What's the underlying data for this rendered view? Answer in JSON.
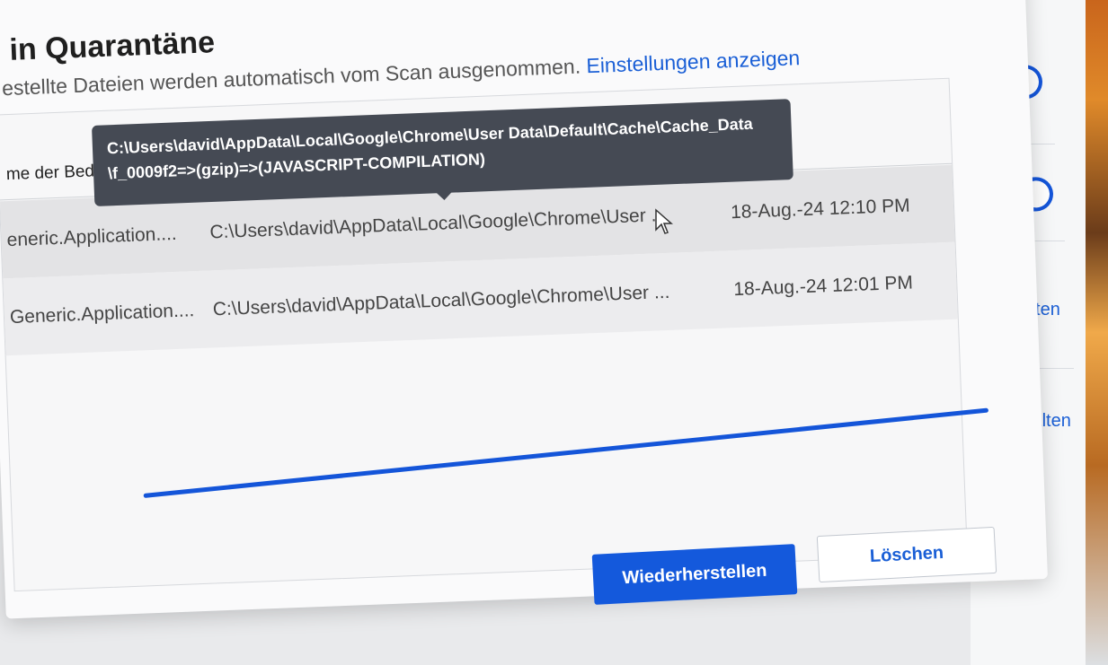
{
  "dialog": {
    "title": "in Quarantäne",
    "subtitle_text": "estellte Dateien werden automatisch vom Scan ausgenommen.",
    "subtitle_link": "Einstellungen anzeigen",
    "column_header": "me der Bed"
  },
  "tooltip": {
    "line1": "C:\\Users\\david\\AppData\\Local\\Google\\Chrome\\User Data\\Default\\Cache\\Cache_Data",
    "line2": "\\f_0009f2=>(gzip)=>(JAVASCRIPT-COMPILATION)"
  },
  "rows": [
    {
      "name": "eneric.Application....",
      "path": "C:\\Users\\david\\AppData\\Local\\Google\\Chrome\\User ...",
      "date": "18-Aug.-24 12:10 PM"
    },
    {
      "name": "Generic.Application....",
      "path": "C:\\Users\\david\\AppData\\Local\\Google\\Chrome\\User ...",
      "date": "18-Aug.-24 12:01 PM"
    }
  ],
  "progress": {
    "percent": 100,
    "color": "#1455d9"
  },
  "buttons": {
    "restore": "Wiederherstellen",
    "delete": "Löschen"
  },
  "side_panel": {
    "link1": "walten",
    "link2": "walten"
  },
  "colors": {
    "accent": "#1459dc",
    "link": "#1a5fd6"
  }
}
